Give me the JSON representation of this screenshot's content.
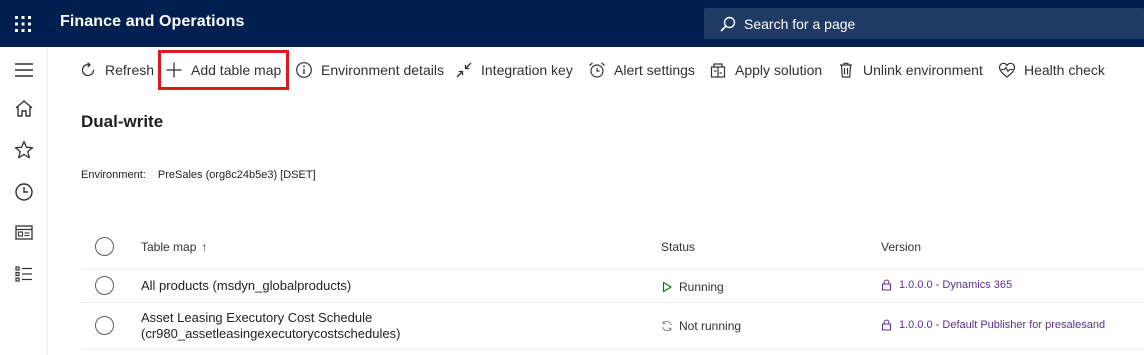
{
  "app": {
    "title": "Finance and Operations"
  },
  "search": {
    "text": "Search for a page"
  },
  "actions": [
    {
      "label": "Refresh",
      "icon": "refresh-icon"
    },
    {
      "label": "Add table map",
      "icon": "add-icon"
    },
    {
      "label": "Environment details",
      "icon": "info-icon"
    },
    {
      "label": "Integration key",
      "icon": "collapse-arrows-icon"
    },
    {
      "label": "Alert settings",
      "icon": "alarm-clock-icon"
    },
    {
      "label": "Apply solution",
      "icon": "package-icon"
    },
    {
      "label": "Unlink environment",
      "icon": "trash-icon"
    },
    {
      "label": "Health check",
      "icon": "heart-pulse-icon"
    }
  ],
  "page": {
    "title": "Dual-write",
    "environment_label": "Environment:",
    "environment_value": "PreSales (org8c24b5e3) [DSET]"
  },
  "grid": {
    "headers": {
      "table_map": "Table map",
      "status": "Status",
      "version": "Version"
    },
    "sort_indicator": "↑",
    "rows": [
      {
        "table_map": "All products (msdyn_globalproducts)",
        "status": "Running",
        "version": "1.0.0.0 - Dynamics 365"
      },
      {
        "table_map_line1": "Asset Leasing Executory Cost Schedule",
        "table_map_line2": "(cr980_assetleasingexecutorycostschedules)",
        "status": "Not running",
        "version": "1.0.0.0 - Default Publisher for presalesand"
      }
    ]
  },
  "colors": {
    "topbar": "#002050",
    "highlight": "#e3151e",
    "version_link": "#5c2e91",
    "running": "#107c10"
  }
}
